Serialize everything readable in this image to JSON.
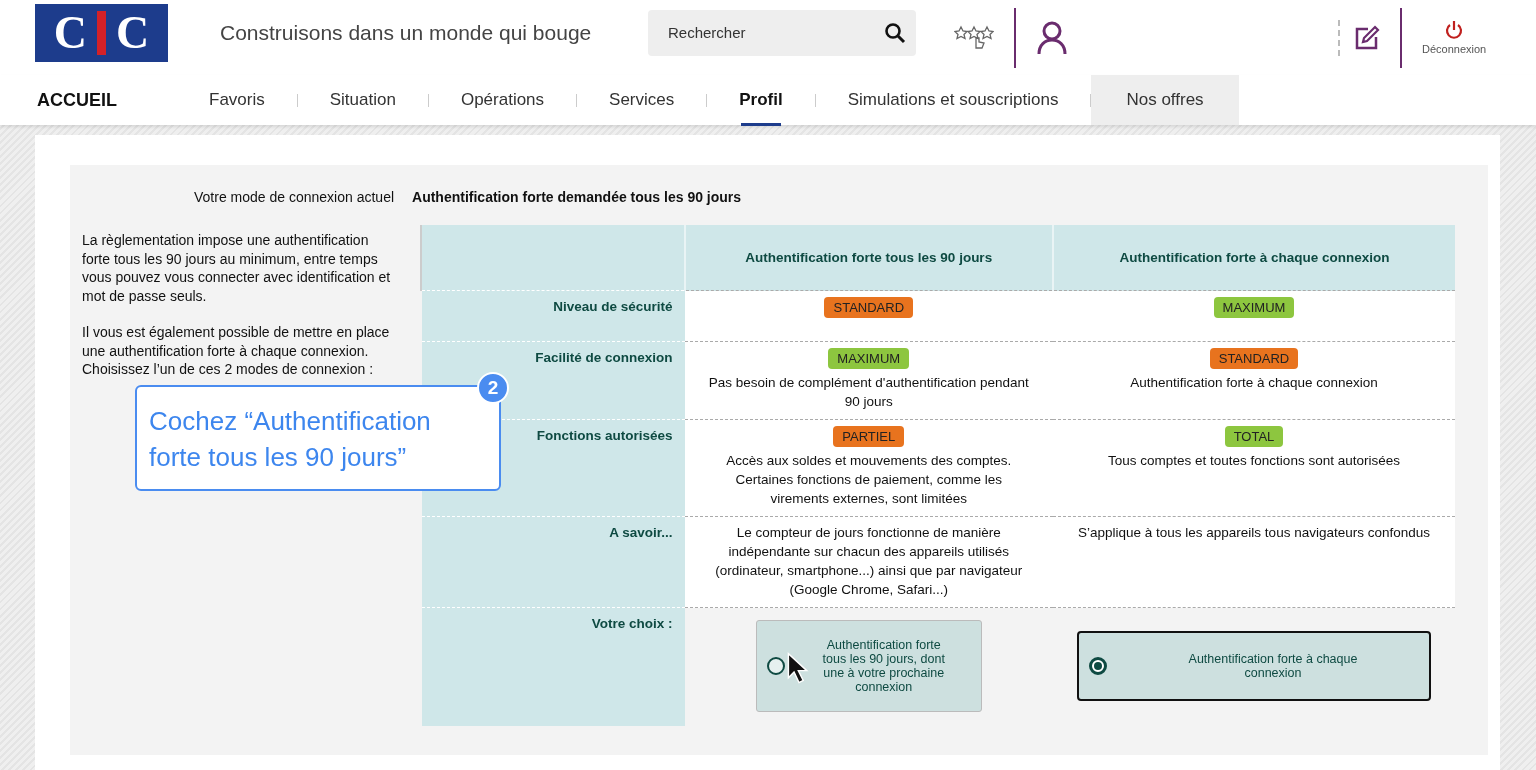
{
  "header": {
    "logo_letters": [
      "C",
      "C"
    ],
    "tagline": "Construisons dans un monde qui bouge",
    "search": {
      "placeholder": "Rechercher"
    },
    "logout_label": "Déconnexion"
  },
  "nav": [
    {
      "label": "ACCUEIL",
      "selected": false,
      "kind": "home",
      "hovered": false
    },
    {
      "label": "Favoris",
      "selected": false,
      "kind": "item",
      "hovered": false
    },
    {
      "label": "Situation",
      "selected": false,
      "kind": "item",
      "hovered": false
    },
    {
      "label": "Opérations",
      "selected": false,
      "kind": "item",
      "hovered": false
    },
    {
      "label": "Services",
      "selected": false,
      "kind": "item",
      "hovered": false
    },
    {
      "label": "Profil",
      "selected": true,
      "kind": "item",
      "hovered": false
    },
    {
      "label": "Simulations et souscriptions",
      "selected": false,
      "kind": "item",
      "hovered": false
    },
    {
      "label": "Nos offres",
      "selected": false,
      "kind": "item",
      "hovered": true
    }
  ],
  "current_mode": {
    "label": "Votre mode de connexion actuel",
    "value": "Authentification forte demandée tous les 90 jours"
  },
  "intro": [
    "La règlementation impose une authentification forte tous les 90 jours au minimum, entre temps vous pouvez vous connecter avec identification et mot de passe seuls.",
    "Il vous est également possible de mettre en place une authentification forte à chaque connexion. Choisissez l’un de ces 2 modes de connexion :"
  ],
  "table": {
    "columns": [
      "Authentification forte tous les 90 jours",
      "Authentification forte à chaque connexion"
    ],
    "rows": [
      {
        "label": "Niveau de sécurité",
        "cells": [
          {
            "badge": "STANDARD",
            "color": "#e8731e"
          },
          {
            "badge": "MAXIMUM",
            "color": "#8dc63f"
          }
        ]
      },
      {
        "label": "Facilité de connexion",
        "cells": [
          {
            "badge": "MAXIMUM",
            "color": "#8dc63f",
            "text": "Pas besoin de complément d'authentification pendant 90 jours"
          },
          {
            "badge": "STANDARD",
            "color": "#e8731e",
            "text": "Authentification forte à chaque connexion"
          }
        ]
      },
      {
        "label": "Fonctions autorisées",
        "cells": [
          {
            "badge": "PARTIEL",
            "color": "#e8731e",
            "text": "Accès aux soldes et mouvements des comptes. Certaines fonctions de paiement, comme les virements externes, sont limitées"
          },
          {
            "badge": "TOTAL",
            "color": "#8dc63f",
            "text": "Tous comptes et toutes fonctions sont autorisées"
          }
        ]
      },
      {
        "label": "A savoir...",
        "cells": [
          {
            "text": "Le compteur de jours fonctionne de manière indépendante sur chacun des appareils utilisés (ordinateur, smartphone...) ainsi que par navigateur (Google Chrome, Safari...)"
          },
          {
            "text": "S’applique à tous les appareils tous navigateurs confondus"
          }
        ]
      }
    ],
    "choice": {
      "label": "Votre choix :",
      "options": [
        {
          "label": "Authentification forte tous les 90 jours, dont une à votre prochaine connexion",
          "selected": false
        },
        {
          "label": "Authentification forte à chaque connexion",
          "selected": true
        }
      ]
    }
  },
  "callout": {
    "step": "2",
    "text": "Cochez “Authentification forte tous les 90 jours”"
  }
}
